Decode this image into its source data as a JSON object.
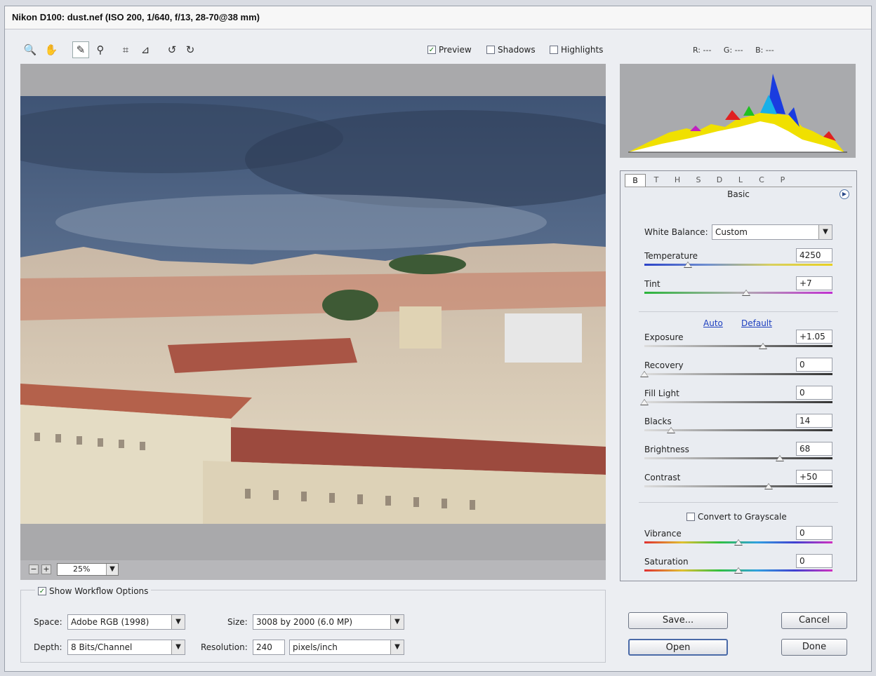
{
  "window": {
    "title": "Nikon D100:  dust.nef  (ISO 200, 1/640, f/13, 28-70@38 mm)"
  },
  "tools": [
    {
      "name": "zoom-tool",
      "icon": "magnifier-icon",
      "glyph": "🔍"
    },
    {
      "name": "hand-tool",
      "icon": "hand-icon",
      "glyph": "✋"
    },
    {
      "name": "white-balance-tool",
      "icon": "eyedropper-icon",
      "glyph": "✎"
    },
    {
      "name": "color-sampler-tool",
      "icon": "color-sampler-icon",
      "glyph": "⚲"
    },
    {
      "name": "crop-tool",
      "icon": "crop-icon",
      "glyph": "⌗"
    },
    {
      "name": "straighten-tool",
      "icon": "straighten-icon",
      "glyph": "⊿"
    },
    {
      "name": "rotate-left-tool",
      "icon": "rotate-ccw-icon",
      "glyph": "↺"
    },
    {
      "name": "rotate-right-tool",
      "icon": "rotate-cw-icon",
      "glyph": "↻"
    }
  ],
  "options": {
    "preview": {
      "label": "Preview",
      "checked": true
    },
    "shadows": {
      "label": "Shadows",
      "checked": false
    },
    "highlights": {
      "label": "Highlights",
      "checked": false
    }
  },
  "readout": {
    "r": "R: ---",
    "g": "G: ---",
    "b": "B: ---"
  },
  "zoom": {
    "minus": "−",
    "plus": "+",
    "value": "25%"
  },
  "panel": {
    "tabs": [
      "B",
      "T",
      "H",
      "S",
      "D",
      "L",
      "C",
      "P"
    ],
    "active_tab": "B",
    "title": "Basic",
    "white_balance": {
      "label": "White Balance:",
      "value": "Custom"
    },
    "auto": "Auto",
    "default": "Default",
    "grayscale": {
      "label": "Convert to Grayscale",
      "checked": false
    },
    "sliders": [
      {
        "key": "temperature",
        "label": "Temperature",
        "value": "4250",
        "pos": 0.23,
        "track": "temp"
      },
      {
        "key": "tint",
        "label": "Tint",
        "value": "+7",
        "pos": 0.54,
        "track": "tint"
      },
      {
        "key": "exposure",
        "label": "Exposure",
        "value": "+1.05",
        "pos": 0.63,
        "track": "dark"
      },
      {
        "key": "recovery",
        "label": "Recovery",
        "value": "0",
        "pos": 0.0,
        "track": "dark"
      },
      {
        "key": "fill-light",
        "label": "Fill Light",
        "value": "0",
        "pos": 0.0,
        "track": "dark"
      },
      {
        "key": "blacks",
        "label": "Blacks",
        "value": "14",
        "pos": 0.14,
        "track": "dark"
      },
      {
        "key": "brightness",
        "label": "Brightness",
        "value": "68",
        "pos": 0.72,
        "track": "dark"
      },
      {
        "key": "contrast",
        "label": "Contrast",
        "value": "+50",
        "pos": 0.66,
        "track": "dark"
      },
      {
        "key": "vibrance",
        "label": "Vibrance",
        "value": "0",
        "pos": 0.5,
        "track": "color"
      },
      {
        "key": "saturation",
        "label": "Saturation",
        "value": "0",
        "pos": 0.5,
        "track": "color"
      }
    ]
  },
  "workflow": {
    "show_label": "Show Workflow Options",
    "show_checked": true,
    "space_label": "Space:",
    "space_value": "Adobe RGB (1998)",
    "depth_label": "Depth:",
    "depth_value": "8 Bits/Channel",
    "size_label": "Size:",
    "size_value": "3008 by 2000  (6.0 MP)",
    "resolution_label": "Resolution:",
    "resolution_value": "240",
    "resolution_unit": "pixels/inch"
  },
  "buttons": {
    "save": "Save...",
    "cancel": "Cancel",
    "open": "Open",
    "done": "Done"
  },
  "colors": {
    "accent": "#1d3fbf",
    "checkmark": "#1a7a1a",
    "preview_bg": "#a9a9ab"
  }
}
